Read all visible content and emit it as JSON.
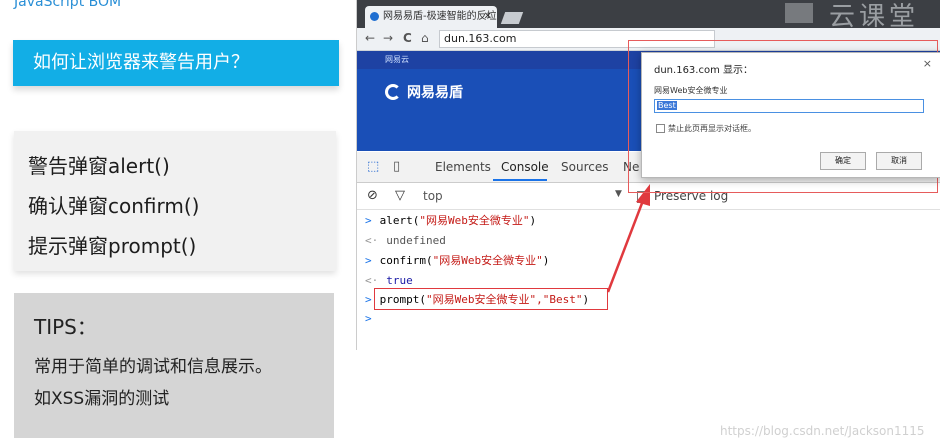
{
  "slide": {
    "title": "JavaScript BOM",
    "question": "如何让浏览器来警告用户？",
    "items": [
      "警告弹窗alert()",
      "确认弹窗confirm()",
      "提示弹窗prompt()"
    ],
    "tips_title": "TIPS：",
    "tips_lines": [
      "常用于简单的调试和信息展示。",
      "如XSS漏洞的测试"
    ]
  },
  "browser": {
    "tab_title": "网易易盾-极速智能的反垃",
    "tab_close": "✕",
    "url": "dun.163.com",
    "nav": {
      "back": "←",
      "forward": "→",
      "reload": "C",
      "home": "⌂"
    },
    "watermark": "云课堂",
    "page_top": "网易云",
    "logo": "网易易盾"
  },
  "devtools": {
    "tabs": [
      "Elements",
      "Console",
      "Sources",
      "Ne"
    ],
    "active_tab": "Console",
    "context": "top",
    "dropdown": "▼",
    "preserve_log": "Preserve log",
    "lines": [
      {
        "type": "in",
        "prefix": ">",
        "code": "alert(",
        "str": "\"网易Web安全微专业\"",
        "suffix": ")"
      },
      {
        "type": "out",
        "prefix": "<·",
        "text": "undefined"
      },
      {
        "type": "in",
        "prefix": ">",
        "code": "confirm(",
        "str": "\"网易Web安全微专业\"",
        "suffix": ")"
      },
      {
        "type": "out",
        "prefix": "<·",
        "text": "true"
      },
      {
        "type": "in",
        "prefix": ">",
        "code": "prompt(",
        "str": "\"网易Web安全微专业\",\"Best\"",
        "suffix": ")"
      },
      {
        "type": "caret",
        "prefix": ">"
      }
    ]
  },
  "dialog": {
    "title": "dun.163.com 显示：",
    "close": "×",
    "message": "网易Web安全微专业",
    "input_value": "Best",
    "checkbox_label": "禁止此页再显示对话框。",
    "ok": "确定",
    "cancel": "取消"
  },
  "footer": "https://blog.csdn.net/Jackson1115",
  "colors": {
    "accent_blue": "#12aee6",
    "annotation_red": "#e65b5b"
  }
}
